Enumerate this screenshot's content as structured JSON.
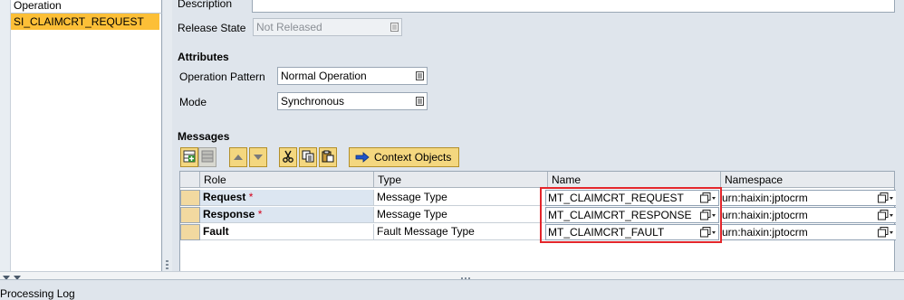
{
  "left_pane": {
    "header": "Operation",
    "selected_operation": "SI_CLAIMCRT_REQUEST"
  },
  "header_fields": {
    "description_label": "Description",
    "description_value": "",
    "release_state_label": "Release State",
    "release_state_value": "Not Released"
  },
  "attributes": {
    "title": "Attributes",
    "operation_pattern_label": "Operation Pattern",
    "operation_pattern_value": "Normal Operation",
    "mode_label": "Mode",
    "mode_value": "Synchronous"
  },
  "messages": {
    "title": "Messages",
    "toolbar": {
      "context_objects_label": "Context Objects"
    },
    "columns": [
      "Role",
      "Type",
      "Name",
      "Namespace"
    ],
    "rows": [
      {
        "role": "Request",
        "required": "*",
        "type": "Message Type",
        "name": "MT_CLAIMCRT_REQUEST",
        "namespace": "urn:haixin:jptocrm"
      },
      {
        "role": "Response",
        "required": "*",
        "type": "Message Type",
        "name": "MT_CLAIMCRT_RESPONSE",
        "namespace": "urn:haixin:jptocrm"
      },
      {
        "role": "Fault",
        "required": "",
        "type": "Fault Message Type",
        "name": "MT_CLAIMCRT_FAULT",
        "namespace": "urn:haixin:jptocrm"
      }
    ]
  },
  "status_bar": {
    "text": "Processing Log"
  },
  "colors": {
    "selection": "#fcbf37",
    "highlight_box": "#e3262b",
    "required_star": "#d4001a"
  }
}
